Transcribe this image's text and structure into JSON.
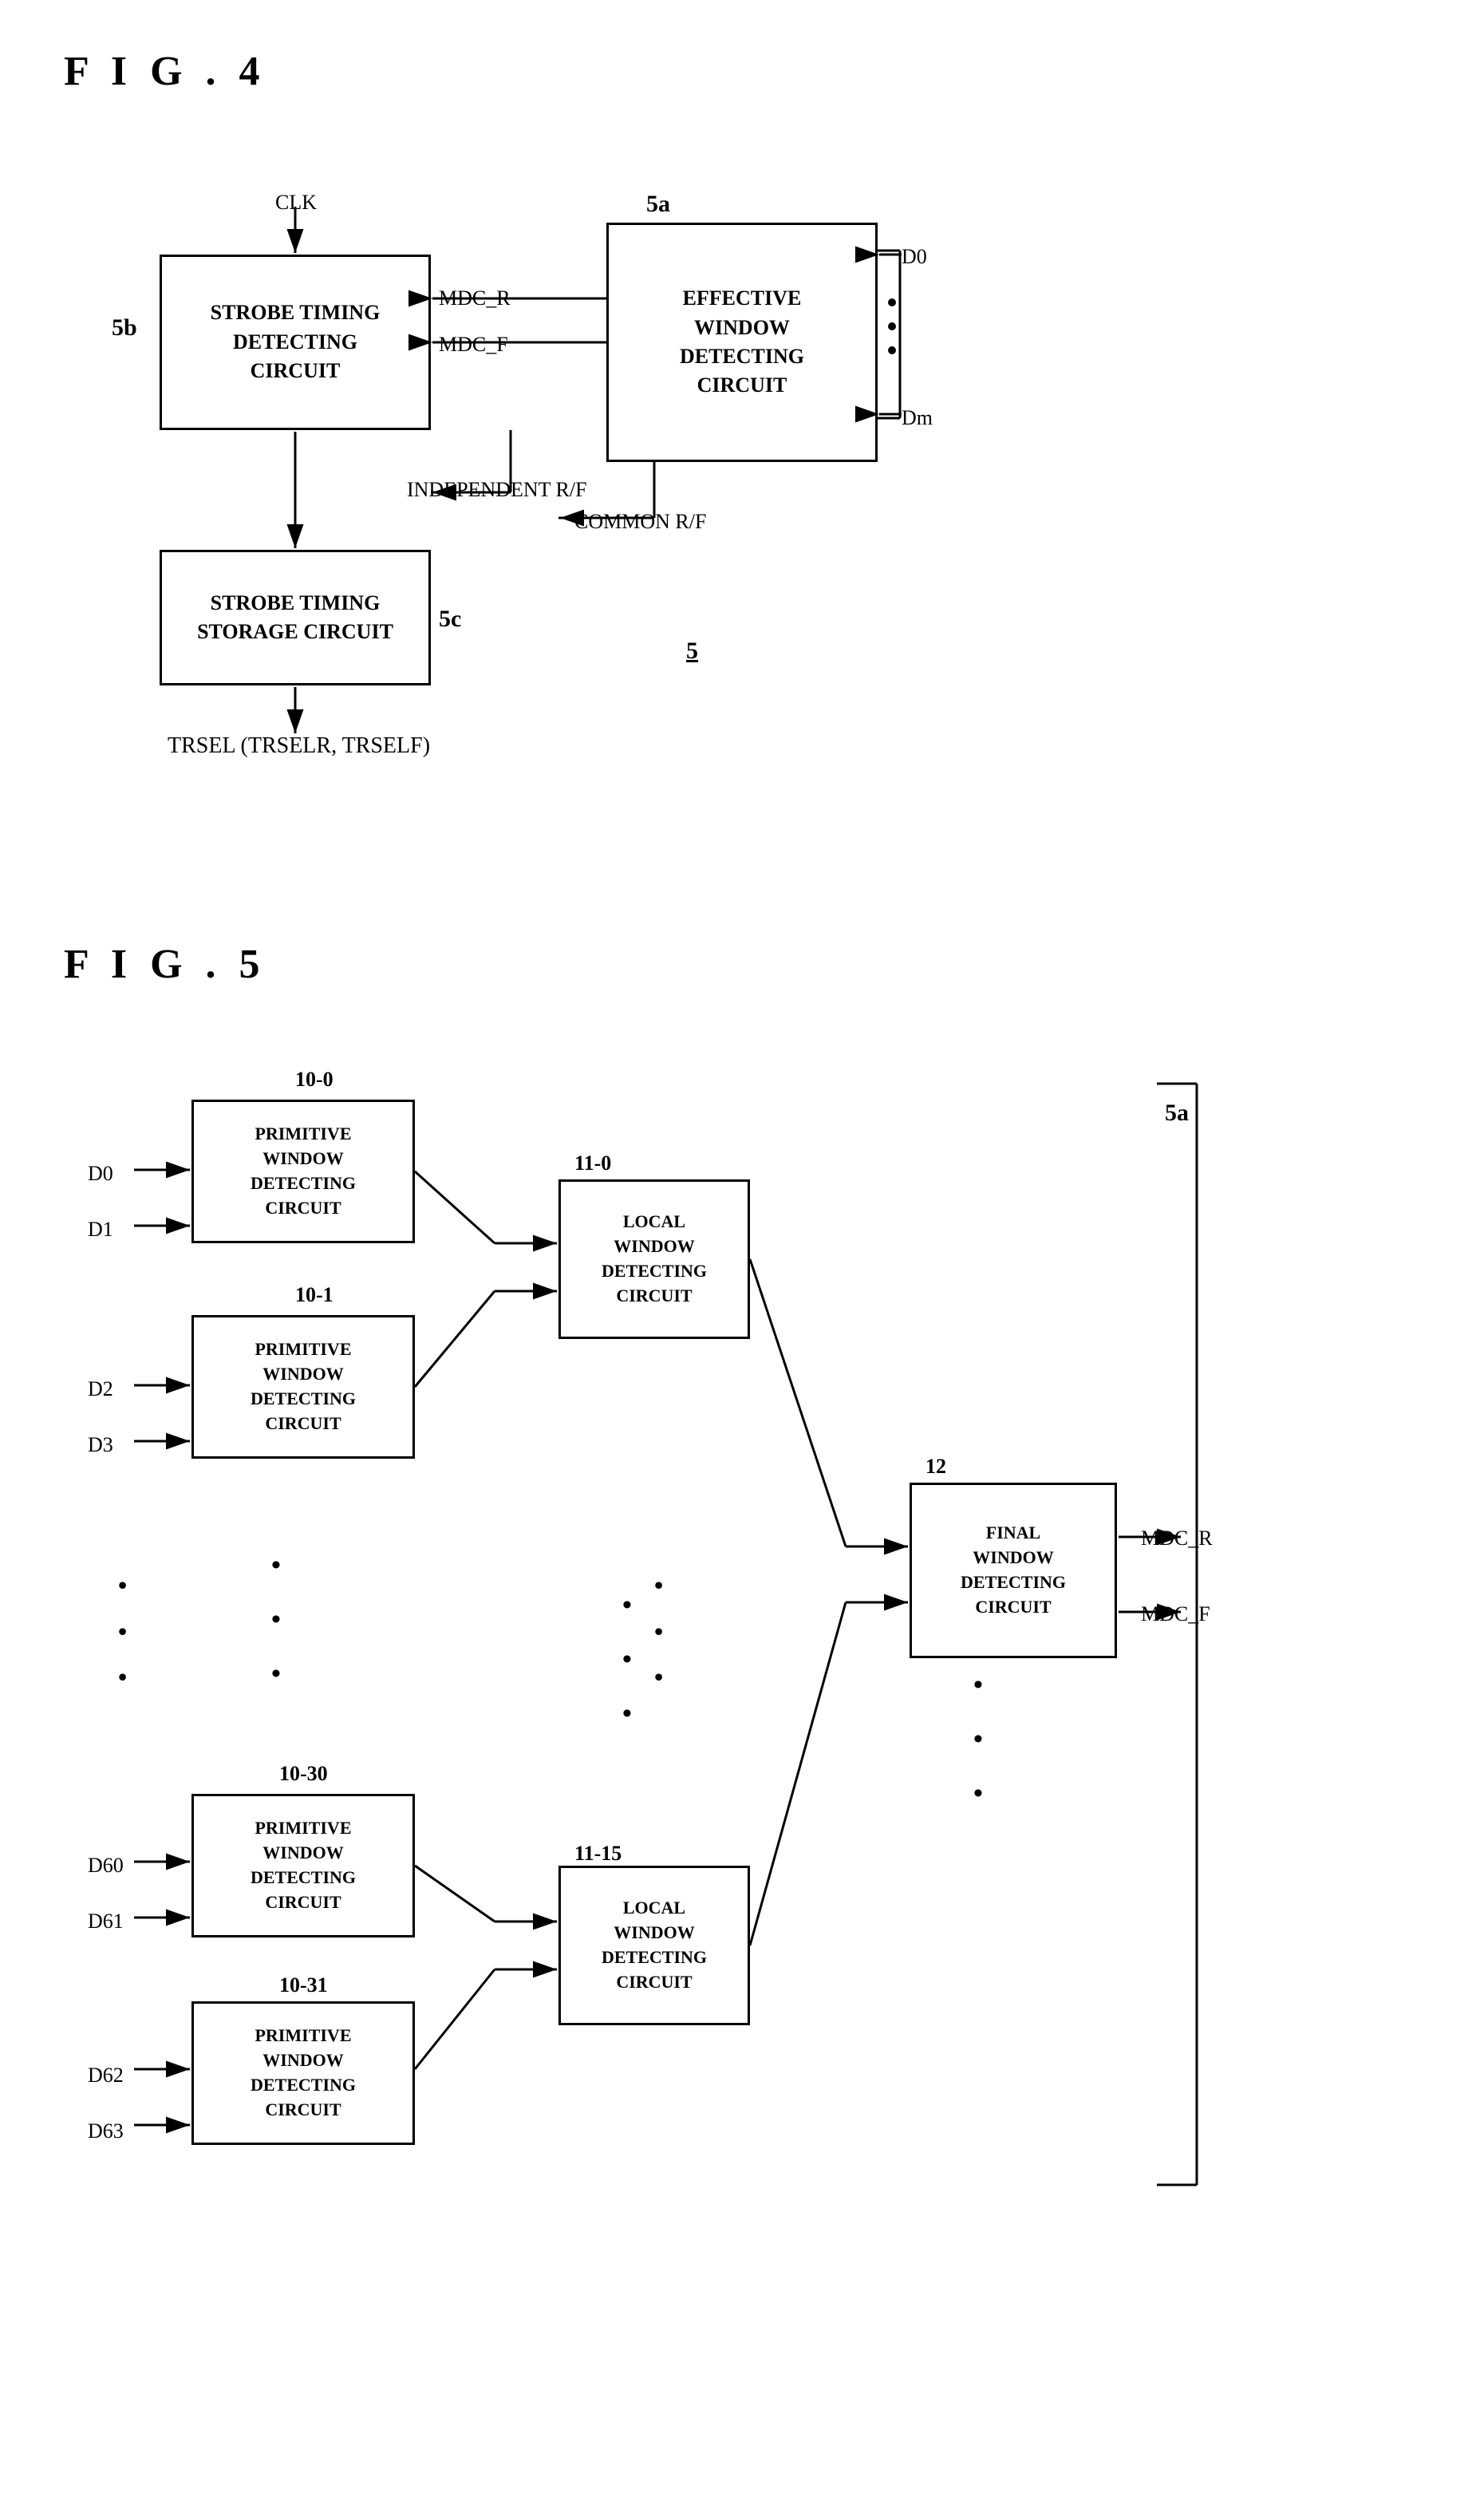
{
  "fig4": {
    "label": "F I G .  4",
    "strobe_timing_detect": "STROBE TIMING\nDETECTING\nCIRCUIT",
    "effective_window": "EFFECTIVE\nWINDOW\nDETECTING\nCIRCUIT",
    "strobe_timing_storage": "STROBE TIMING\nSTORAGE CIRCUIT",
    "ref_5a": "5a",
    "ref_5b": "5b",
    "ref_5c": "5c",
    "ref_5": "5",
    "clk": "CLK",
    "mdc_r": "MDC_R",
    "mdc_f": "MDC_F",
    "independent_rf": "INDEPENDENT R/F",
    "common_rf": "COMMON R/F",
    "d0": "D0",
    "dm": "Dm",
    "trsel": "TRSEL (TRSELR, TRSELF)"
  },
  "fig5": {
    "label": "F I G .  5",
    "primitive_window_0": "PRIMITIVE\nWINDOW\nDETECTING\nCIRCUIT",
    "primitive_window_1": "PRIMITIVE\nWINDOW\nDETECTING\nCIRCUIT",
    "primitive_window_30": "PRIMITIVE\nWINDOW\nDETECTING\nCIRCUIT",
    "primitive_window_31": "PRIMITIVE\nWINDOW\nDETECTING\nCIRCUIT",
    "local_window_0": "LOCAL\nWINDOW\nDETECTING\nCIRCUIT",
    "local_window_15": "LOCAL\nWINDOW\nDETECTING\nCIRCUIT",
    "final_window": "FINAL\nWINDOW\nDETECTING\nCIRCUIT",
    "ref_5a": "5a",
    "ref_10_0": "10-0",
    "ref_10_1": "10-1",
    "ref_10_30": "10-30",
    "ref_10_31": "10-31",
    "ref_11_0": "11-0",
    "ref_11_15": "11-15",
    "ref_12": "12",
    "d0": "D0",
    "d1": "D1",
    "d2": "D2",
    "d3": "D3",
    "d60": "D60",
    "d61": "D61",
    "d62": "D62",
    "d63": "D63",
    "mdc_r": "MDC_R",
    "mdc_f": "MDC_F",
    "dots1": "•\n•\n•",
    "dots2": "•\n•\n•"
  }
}
